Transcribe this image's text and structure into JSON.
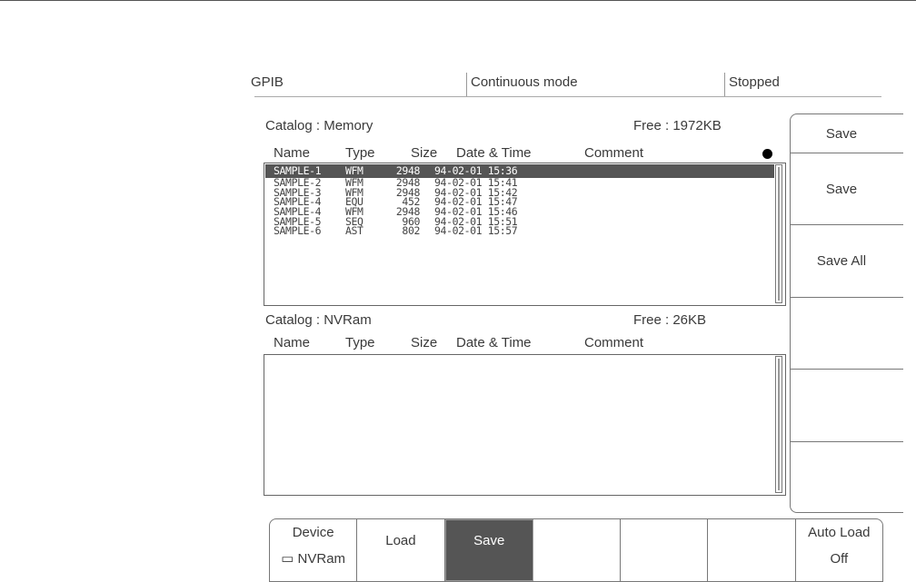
{
  "status_bar": {
    "interface": "GPIB",
    "mode": "Continuous mode",
    "state": "Stopped"
  },
  "memory": {
    "title": "Catalog : Memory",
    "free": "Free : 1972KB",
    "columns": [
      "Name",
      "Type",
      "Size",
      "Date & Time",
      "Comment"
    ],
    "rows": [
      {
        "name": "SAMPLE-1",
        "type": "WFM",
        "size": "2948",
        "datetime": "94-02-01 15:36",
        "comment": ""
      },
      {
        "name": "SAMPLE-2",
        "type": "WFM",
        "size": "2948",
        "datetime": "94-02-01 15:41",
        "comment": ""
      },
      {
        "name": "SAMPLE-3",
        "type": "WFM",
        "size": "2948",
        "datetime": "94-02-01 15:42",
        "comment": ""
      },
      {
        "name": "SAMPLE-4",
        "type": "EQU",
        "size": "452",
        "datetime": "94-02-01 15:47",
        "comment": ""
      },
      {
        "name": "SAMPLE-4",
        "type": "WFM",
        "size": "2948",
        "datetime": "94-02-01 15:46",
        "comment": ""
      },
      {
        "name": "SAMPLE-5",
        "type": "SEQ",
        "size": "960",
        "datetime": "94-02-01 15:51",
        "comment": ""
      },
      {
        "name": "SAMPLE-6",
        "type": "AST",
        "size": "802",
        "datetime": "94-02-01 15:57",
        "comment": ""
      }
    ],
    "selected_index": 0
  },
  "nvram": {
    "title": "Catalog : NVRam",
    "free": "Free : 26KB",
    "columns": [
      "Name",
      "Type",
      "Size",
      "Date & Time",
      "Comment"
    ]
  },
  "side_menu": {
    "title": "Save",
    "items": [
      "Save",
      "Save All",
      "",
      "",
      ""
    ]
  },
  "bottom_menu": [
    {
      "line1": "Device",
      "line2": "▭ NVRam"
    },
    {
      "line1": "Load",
      "line2": ""
    },
    {
      "line1": "Save",
      "line2": "",
      "selected": true
    },
    {
      "line1": "",
      "line2": ""
    },
    {
      "line1": "",
      "line2": ""
    },
    {
      "line1": "",
      "line2": ""
    },
    {
      "line1": "Auto Load",
      "line2": "Off"
    }
  ]
}
